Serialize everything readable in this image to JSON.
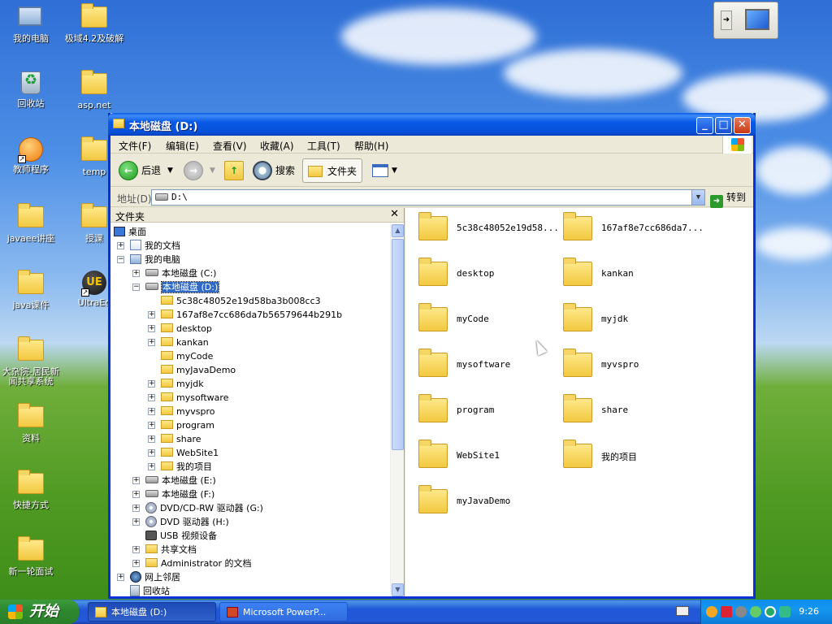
{
  "desktop": {
    "icons": [
      {
        "label": "我的电脑"
      },
      {
        "label": "极域4.2及破解"
      },
      {
        "label": "回收站"
      },
      {
        "label": "asp.net"
      },
      {
        "label": "教师程序"
      },
      {
        "label": "temp"
      },
      {
        "label": "javaee讲座"
      },
      {
        "label": "授课"
      },
      {
        "label": "java课件"
      },
      {
        "label": "UltraEd"
      },
      {
        "label": "大杂院-居民新闻共享系统"
      },
      {
        "label": "资料"
      },
      {
        "label": "快捷方式"
      },
      {
        "label": "新一轮面试"
      }
    ]
  },
  "window": {
    "title": "本地磁盘 (D:)",
    "menu": [
      "文件(F)",
      "编辑(E)",
      "查看(V)",
      "收藏(A)",
      "工具(T)",
      "帮助(H)"
    ],
    "toolbar": {
      "back": "后退",
      "search": "搜索",
      "folders": "文件夹"
    },
    "address": {
      "label": "地址(D)",
      "value": "D:\\",
      "go": "转到"
    },
    "tree_title": "文件夹",
    "tree": [
      {
        "label": "桌面",
        "icon": "desktop"
      },
      {
        "label": "我的文档",
        "icon": "doc"
      },
      {
        "label": "我的电脑",
        "icon": "pc"
      },
      {
        "label": "本地磁盘 (C:)",
        "icon": "drive"
      },
      {
        "label": "本地磁盘 (D:)",
        "icon": "drive"
      },
      {
        "label": "5c38c48052e19d58ba3b008cc3",
        "icon": "folder"
      },
      {
        "label": "167af8e7cc686da7b56579644b291b",
        "icon": "folder"
      },
      {
        "label": "desktop",
        "icon": "folder"
      },
      {
        "label": "kankan",
        "icon": "folder"
      },
      {
        "label": "myCode",
        "icon": "folder"
      },
      {
        "label": "myJavaDemo",
        "icon": "folder"
      },
      {
        "label": "myjdk",
        "icon": "folder"
      },
      {
        "label": "mysoftware",
        "icon": "folder"
      },
      {
        "label": "myvspro",
        "icon": "folder"
      },
      {
        "label": "program",
        "icon": "folder"
      },
      {
        "label": "share",
        "icon": "folder"
      },
      {
        "label": "WebSite1",
        "icon": "folder"
      },
      {
        "label": "我的项目",
        "icon": "folder"
      },
      {
        "label": "本地磁盘 (E:)",
        "icon": "drive"
      },
      {
        "label": "本地磁盘 (F:)",
        "icon": "drive"
      },
      {
        "label": "DVD/CD-RW 驱动器 (G:)",
        "icon": "dvd"
      },
      {
        "label": "DVD 驱动器 (H:)",
        "icon": "dvd"
      },
      {
        "label": "USB 视频设备",
        "icon": "cam"
      },
      {
        "label": "共享文档",
        "icon": "folder"
      },
      {
        "label": "Administrator 的文档",
        "icon": "folder"
      },
      {
        "label": "网上邻居",
        "icon": "net"
      },
      {
        "label": "回收站",
        "icon": "bin"
      }
    ],
    "items": [
      {
        "label": "5c38c48052e19d58..."
      },
      {
        "label": "167af8e7cc686da7..."
      },
      {
        "label": "desktop"
      },
      {
        "label": "kankan"
      },
      {
        "label": "myCode"
      },
      {
        "label": "myjdk"
      },
      {
        "label": "mysoftware"
      },
      {
        "label": "myvspro"
      },
      {
        "label": "program"
      },
      {
        "label": "share"
      },
      {
        "label": "WebSite1"
      },
      {
        "label": "我的项目"
      },
      {
        "label": "myJavaDemo"
      }
    ]
  },
  "taskbar": {
    "start": "开始",
    "tasks": [
      "本地磁盘 (D:)",
      "Microsoft PowerP..."
    ],
    "clock": "9:26"
  },
  "colors": {
    "title_blue": "#0a5ae8",
    "selection": "#316ac5",
    "start_green": "#2f8a2f"
  }
}
